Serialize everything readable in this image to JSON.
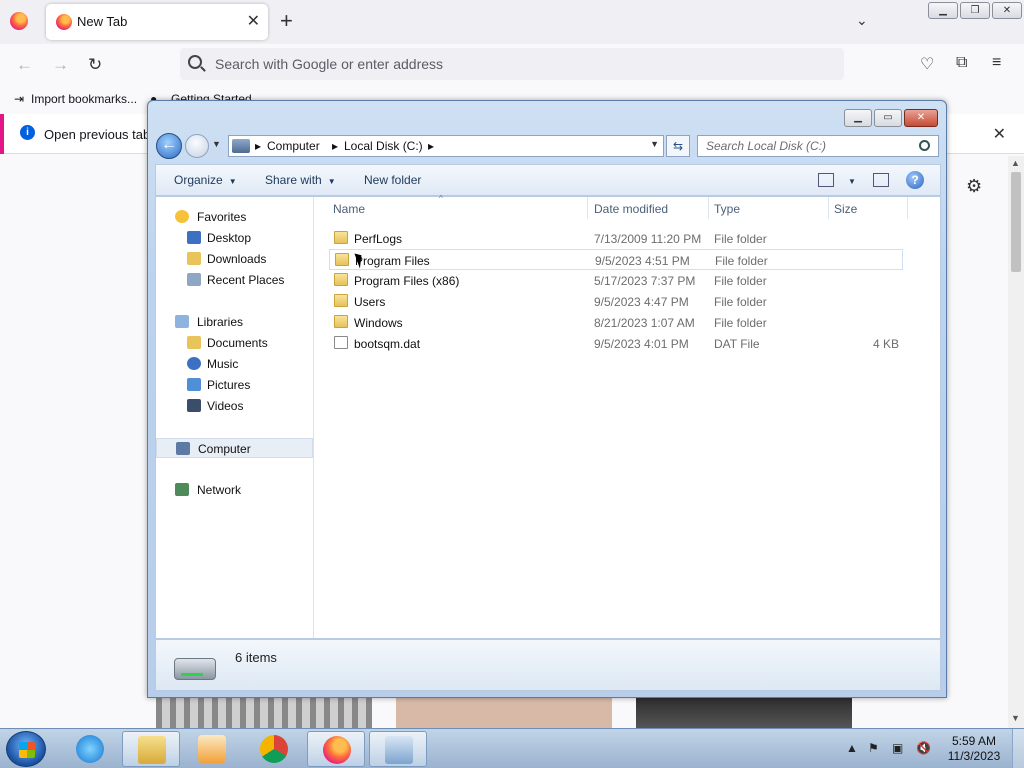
{
  "firefox": {
    "tab_title": "New Tab",
    "url_placeholder": "Search with Google or enter address",
    "bookmarks": {
      "import": "Import bookmarks...",
      "getting_started": "Getting Started"
    },
    "notice": "Open previous tabs"
  },
  "explorer": {
    "breadcrumbs": [
      "Computer",
      "Local Disk (C:)"
    ],
    "search_placeholder": "Search Local Disk (C:)",
    "commands": {
      "organize": "Organize",
      "share_with": "Share with",
      "new_folder": "New folder"
    },
    "nav": {
      "favorites": "Favorites",
      "desktop": "Desktop",
      "downloads": "Downloads",
      "recent": "Recent Places",
      "libraries": "Libraries",
      "documents": "Documents",
      "music": "Music",
      "pictures": "Pictures",
      "videos": "Videos",
      "computer": "Computer",
      "network": "Network"
    },
    "columns": {
      "name": "Name",
      "date": "Date modified",
      "type": "Type",
      "size": "Size"
    },
    "files": [
      {
        "name": "PerfLogs",
        "date": "7/13/2009 11:20 PM",
        "type": "File folder",
        "size": ""
      },
      {
        "name": "Program Files",
        "date": "9/5/2023 4:51 PM",
        "type": "File folder",
        "size": ""
      },
      {
        "name": "Program Files (x86)",
        "date": "5/17/2023 7:37 PM",
        "type": "File folder",
        "size": ""
      },
      {
        "name": "Users",
        "date": "9/5/2023 4:47 PM",
        "type": "File folder",
        "size": ""
      },
      {
        "name": "Windows",
        "date": "8/21/2023 1:07 AM",
        "type": "File folder",
        "size": ""
      },
      {
        "name": "bootsqm.dat",
        "date": "9/5/2023 4:01 PM",
        "type": "DAT File",
        "size": "4 KB"
      }
    ],
    "item_count": "6 items"
  },
  "taskbar": {
    "time": "5:59 AM",
    "date": "11/3/2023"
  },
  "colors": {
    "explorer_frame": "#b7cdea",
    "accent": "#2b6cc2",
    "firefox_accent": "#e31587"
  }
}
